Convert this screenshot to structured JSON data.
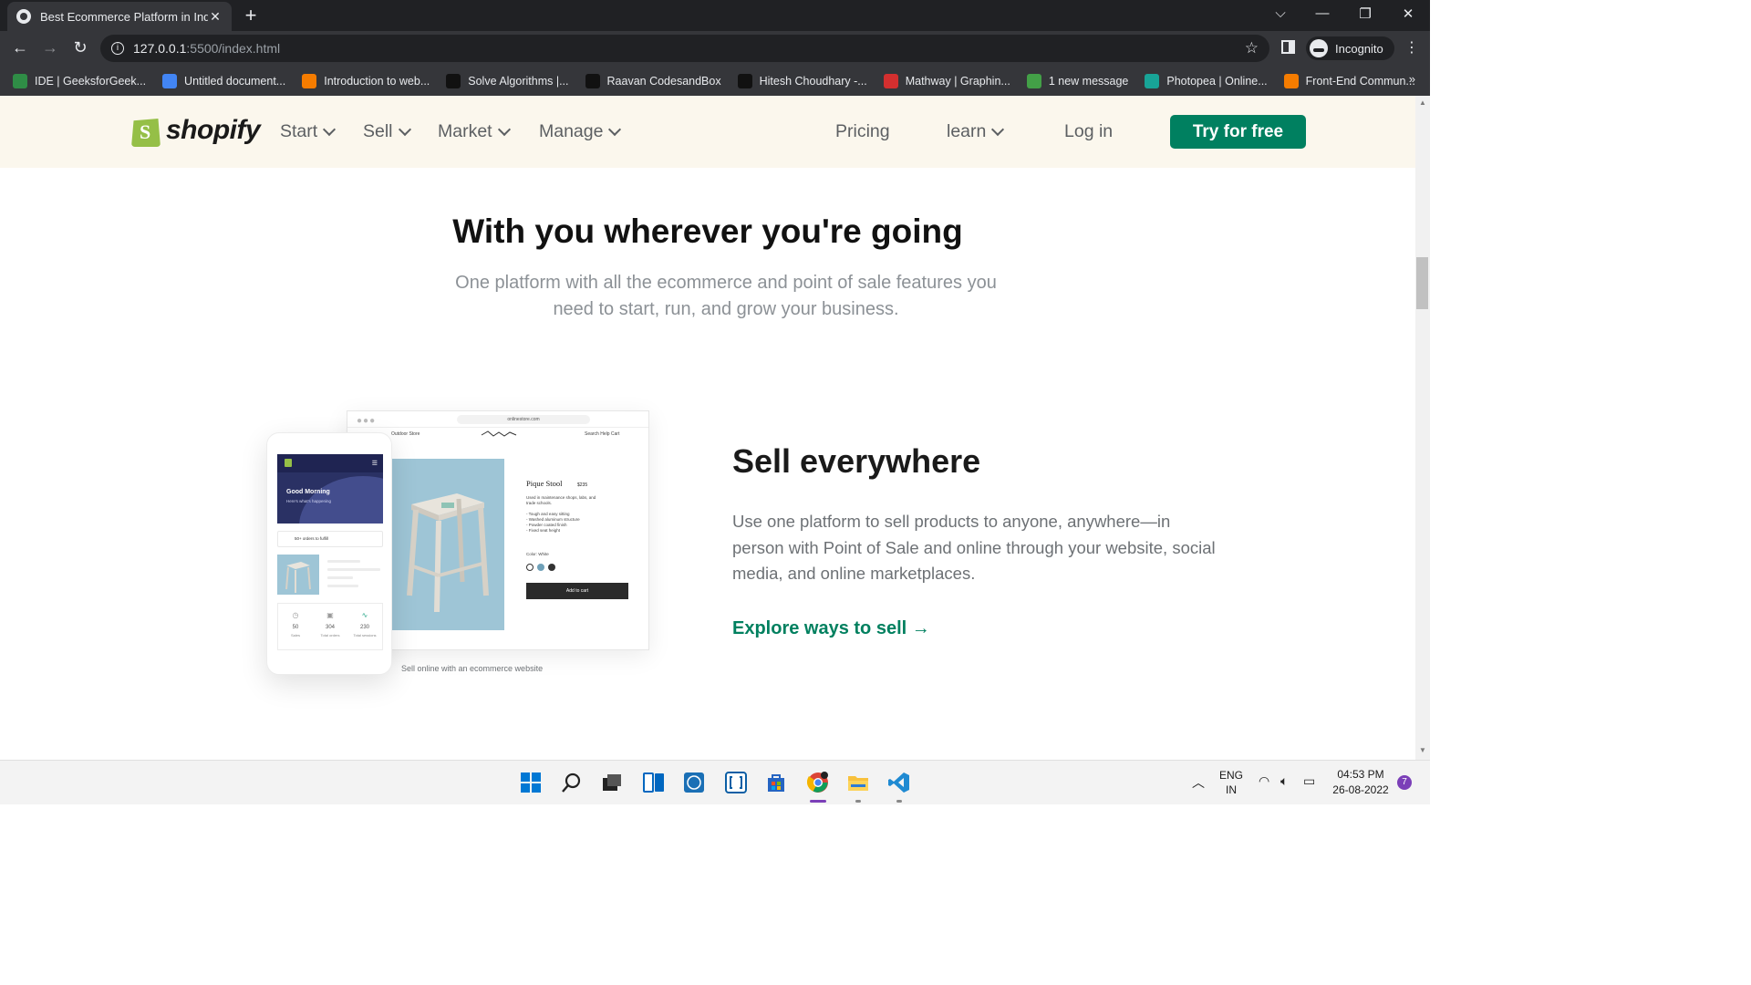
{
  "browser": {
    "tab_title": "Best Ecommerce Platform in India",
    "new_tab_symbol": "+",
    "url_host": "127.0.0.1",
    "url_path": ":5500/index.html",
    "profile_label": "Incognito",
    "bookmarks": [
      {
        "label": "IDE | GeeksforGeek...",
        "color": "#2f8d46"
      },
      {
        "label": "Untitled document...",
        "color": "#4285f4"
      },
      {
        "label": "Introduction to web...",
        "color": "#f57c00"
      },
      {
        "label": "Solve Algorithms |...",
        "color": "#111111"
      },
      {
        "label": "Raavan CodesandBox",
        "color": "#111111"
      },
      {
        "label": "Hitesh Choudhary -...",
        "color": "#111111"
      },
      {
        "label": "Mathway | Graphin...",
        "color": "#d32f2f"
      },
      {
        "label": "1 new message",
        "color": "#43a047"
      },
      {
        "label": "Photopea | Online...",
        "color": "#18a497"
      },
      {
        "label": "Front-End Commun...",
        "color": "#f57c00"
      }
    ],
    "bookmarks_more": "»"
  },
  "header": {
    "logo_text": "shopify",
    "logo_letter": "S",
    "nav_left": [
      "Start",
      "Sell",
      "Market",
      "Manage"
    ],
    "nav_pricing": "Pricing",
    "nav_learn": "learn",
    "nav_login": "Log in",
    "cta_label": "Try for free",
    "brand_color": "#008060"
  },
  "hero": {
    "title": "With you wherever you're going",
    "subtitle": "One platform with all the ecommerce and point of sale features you need to start, run, and grow your business."
  },
  "mockup": {
    "address": "onlinestore.com",
    "nav_links": "Outdoor   Store",
    "nav_right": "Search   Help   Cart",
    "product_title": "Pique Stool",
    "product_price": "$235",
    "product_desc": "Used in maintenance shops, labs, and trade schools.",
    "product_bullets": "- Tough and easy sitting\n- Washed aluminum structure\n- Powder coated finish\n- Fixed seat height",
    "color_label": "Color: White",
    "add_to_cart": "Add to cart",
    "phone_greeting": "Good Morning",
    "phone_sub": "Here's what's happening",
    "phone_orders": "50+ orders to fulfill",
    "stats": [
      {
        "value": "50",
        "label": "Sales"
      },
      {
        "value": "304",
        "label": "Total orders"
      },
      {
        "value": "230",
        "label": "Total sessions"
      }
    ],
    "caption": "Sell online with an ecommerce website"
  },
  "sell": {
    "title": "Sell everywhere",
    "body": "Use one platform to sell products to anyone, anywhere—in person with Point of Sale and online through your website, social media, and online marketplaces.",
    "link": "Explore ways to sell →"
  },
  "taskbar": {
    "lang_top": "ENG",
    "lang_bottom": "IN",
    "time": "04:53 PM",
    "date": "26-08-2022",
    "notifications": "7"
  }
}
